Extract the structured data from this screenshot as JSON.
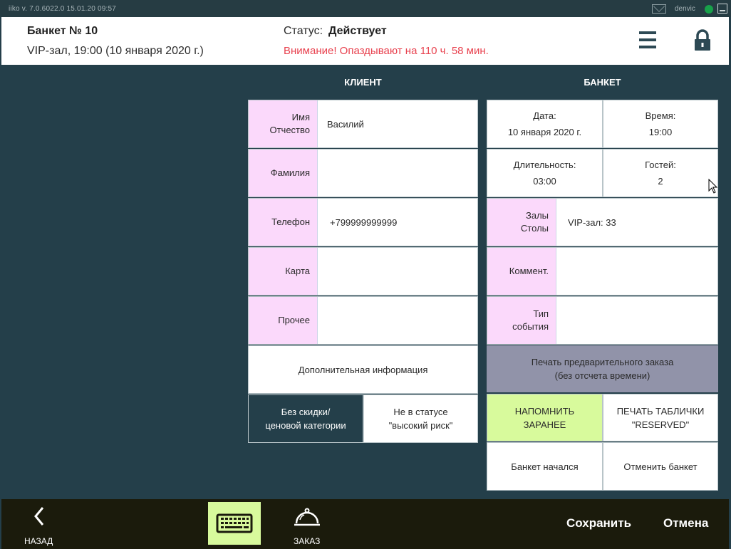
{
  "system_bar": {
    "version": "iiko  v. 7.0.6022.0     15.01.20    09:57",
    "user": "denvic"
  },
  "header": {
    "title": "Банкет № 10",
    "subtitle": "VIP-зал, 19:00 (10 января 2020 г.)",
    "status_label": "Статус:",
    "status_value": "Действует",
    "warning": "Внимание! Опаздывают на 110 ч. 58 мин."
  },
  "client": {
    "title": "КЛИЕНТ",
    "first_name": {
      "label_1": "Имя",
      "label_2": "Отчество",
      "value": "Василий"
    },
    "last_name": {
      "label": "Фамилия",
      "value": ""
    },
    "phone": {
      "label": "Телефон",
      "value": "+799999999999"
    },
    "card": {
      "label": "Карта",
      "value": ""
    },
    "other": {
      "label": "Прочее",
      "value": ""
    },
    "additional_info": "Дополнительная информация",
    "discount": {
      "line1": "Без скидки/",
      "line2": "ценовой категории"
    },
    "risk": {
      "line1": "Не в статусе",
      "line2": "\"высокий риск\""
    }
  },
  "banquet": {
    "title": "БАНКЕТ",
    "date": {
      "label": "Дата:",
      "value": "10 января 2020 г."
    },
    "time": {
      "label": "Время:",
      "value": "19:00"
    },
    "duration": {
      "label": "Длительность:",
      "value": "03:00"
    },
    "guests": {
      "label": "Гостей:",
      "value": "2"
    },
    "halls": {
      "label_1": "Залы",
      "label_2": "Столы",
      "value": "VIP-зал: 33"
    },
    "comment": {
      "label": "Коммент.",
      "value": ""
    },
    "event_type": {
      "label_1": "Тип",
      "label_2": "события",
      "value": ""
    },
    "print_preorder": {
      "line1": "Печать предварительного заказа",
      "line2": "(без отсчета времени)"
    },
    "remind": {
      "line1": "НАПОМНИТЬ",
      "line2": "ЗАРАНЕЕ"
    },
    "print_sign": {
      "line1": "ПЕЧАТЬ ТАБЛИЧКИ",
      "line2": "\"RESERVED\""
    },
    "started": "Банкет начался",
    "cancel_banquet": "Отменить банкет"
  },
  "toolbar": {
    "back": "НАЗАД",
    "order": "ЗАКАЗ",
    "save": "Сохранить",
    "cancel": "Отмена"
  },
  "colors": {
    "background": "#243f4a",
    "label_bg": "#fbd9fb",
    "warning": "#e8424f",
    "accent_green": "#d8fa9c",
    "print_btn": "#9193a9",
    "toolbar": "#1b1b0c"
  }
}
